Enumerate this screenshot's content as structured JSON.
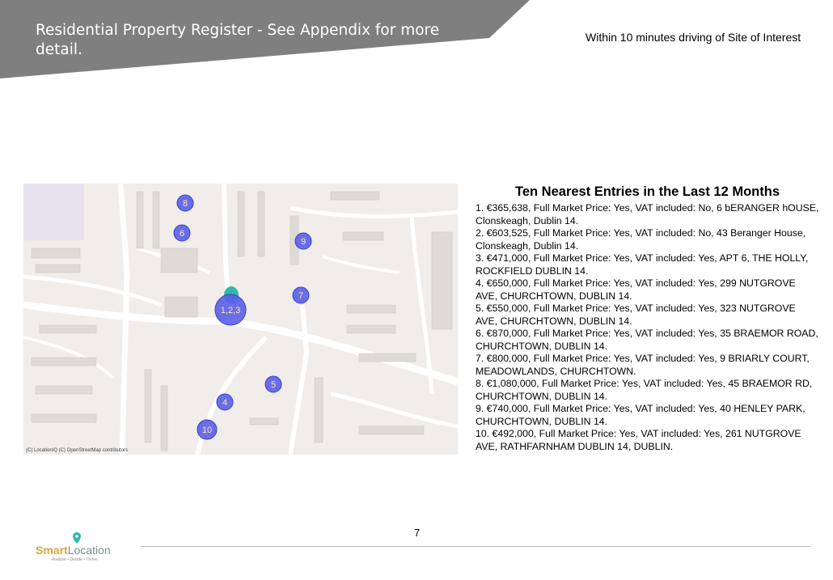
{
  "header": {
    "title": "Residential Property Register - See Appendix for more detail.",
    "subtitle": "Within 10 minutes driving of Site of Interest",
    "band_color": "#7f7f7f"
  },
  "map": {
    "attribution": "(C) LocationIQ (C) OpenStreetMap contributors",
    "marker_color": "#5a5ee8",
    "site_marker_color": "#2fb8a8",
    "markers": [
      {
        "label": "1,2,3",
        "large": true
      },
      {
        "label": "4"
      },
      {
        "label": "5"
      },
      {
        "label": "6"
      },
      {
        "label": "7"
      },
      {
        "label": "8"
      },
      {
        "label": "9"
      },
      {
        "label": "10"
      }
    ]
  },
  "entries": {
    "title": "Ten Nearest Entries in the Last 12 Months",
    "items": [
      "1. €365,638, Full Market Price: Yes, VAT included: No, 6 bERANGER hOUSE, Clonskeagh, Dublin 14.",
      "2. €603,525, Full Market Price: Yes, VAT included: No, 43 Beranger House, Clonskeagh, Dublin 14.",
      "3. €471,000, Full Market Price: Yes, VAT included: Yes, APT 6, THE HOLLY, ROCKFIELD DUBLIN 14.",
      "4. €650,000, Full Market Price: Yes, VAT included: Yes, 299 NUTGROVE AVE, CHURCHTOWN, DUBLIN 14.",
      "5. €550,000, Full Market Price: Yes, VAT included: Yes, 323 NUTGROVE AVE, CHURCHTOWN, DUBLIN 14.",
      "6. €870,000, Full Market Price: Yes, VAT included: Yes, 35 BRAEMOR ROAD, CHURCHTOWN, DUBLIN 14.",
      "7. €800,000, Full Market Price: Yes, VAT included: Yes, 9 BRIARLY COURT, MEADOWLANDS, CHURCHTOWN.",
      "8. €1,080,000, Full Market Price: Yes, VAT included: Yes, 45 BRAEMOR RD, CHURCHTOWN, DUBLIN 14.",
      "9. €740,000, Full Market Price: Yes, VAT included: Yes, 40 HENLEY PARK, CHURCHTOWN, DUBLIN 14.",
      "10. €492,000, Full Market Price: Yes, VAT included: Yes, 261 NUTGROVE AVE, RATHFARNHAM DUBLIN 14, DUBLIN."
    ]
  },
  "footer": {
    "page_number": "7",
    "logo": {
      "part1": "Smart",
      "part2": "Location",
      "tagline": "Analyse • Decide • Thrive"
    }
  }
}
